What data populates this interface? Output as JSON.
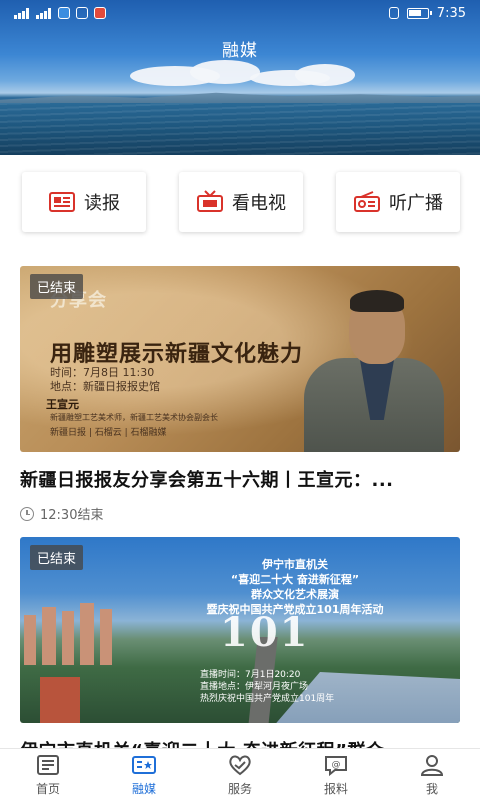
{
  "status_bar": {
    "time": "7:35",
    "left_icons": [
      "signal-icon",
      "signal-icon",
      "app-icon-blue",
      "message-icon",
      "app-icon-red"
    ],
    "right_icons": [
      "vibrate-icon",
      "battery-icon"
    ]
  },
  "header": {
    "title": "融媒"
  },
  "quick_actions": [
    {
      "label": "读报",
      "icon": "newspaper-icon"
    },
    {
      "label": "看电视",
      "icon": "tv-icon"
    },
    {
      "label": "听广播",
      "icon": "radio-icon"
    }
  ],
  "cards": [
    {
      "badge": "已结束",
      "image_text": {
        "small_title": "分享会",
        "headline": "用雕塑展示新疆文化魅力",
        "time_line": "时间：7月8日 11:30",
        "place_line": "地点：新疆日报报史馆",
        "guest_name": "王宣元",
        "guest_desc": "新疆雕塑工艺美术师，新疆工艺美术协会副会长",
        "footer": "新疆日报 | 石榴云 | 石榴融媒"
      },
      "title": "新疆日报报友分享会第五十六期丨王宣元：...",
      "meta": "12:30结束"
    },
    {
      "badge": "已结束",
      "image_text": {
        "org": "伊宁市直机关",
        "line1": "“喜迎二十大 奋进新征程”",
        "line2": "群众文化艺术展演",
        "line3": "暨庆祝中国共产党成立101周年活动",
        "big": "101",
        "time_line": "直播时间：7月1日20:20",
        "place_line": "直播地点：伊犁河月夜广场",
        "footer": "热烈庆祝中国共产党成立101周年"
      },
      "title": "伊宁市直机关“喜迎二十大 奋进新征程”群众",
      "meta": ""
    }
  ],
  "bottom_nav": [
    {
      "label": "首页",
      "icon": "home-icon",
      "active": false
    },
    {
      "label": "融媒",
      "icon": "media-icon",
      "active": true
    },
    {
      "label": "服务",
      "icon": "service-icon",
      "active": false
    },
    {
      "label": "报料",
      "icon": "report-icon",
      "active": false
    },
    {
      "label": "我",
      "icon": "profile-icon",
      "active": false
    }
  ],
  "colors": {
    "accent": "#1f6fd8",
    "quick_icon_red": "#d9332b"
  }
}
